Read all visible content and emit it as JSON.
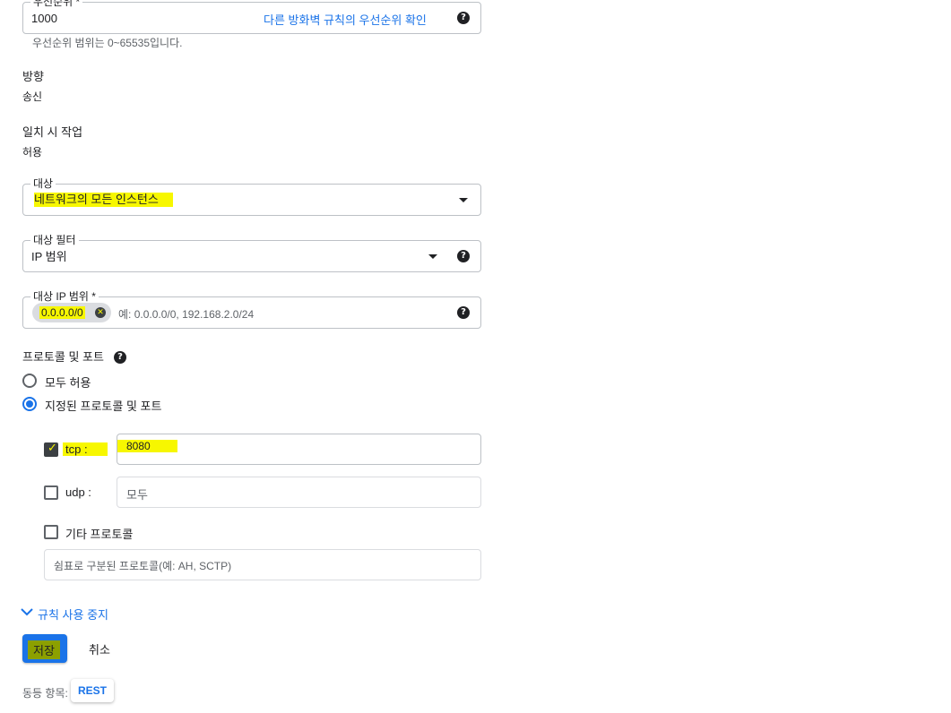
{
  "priority": {
    "label": "우선순위 *",
    "value": "1000",
    "link": "다른 방화벽 규칙의 우선순위 확인",
    "hint": "우선순위 범위는 0~65535입니다."
  },
  "direction": {
    "label": "방향",
    "value": "송신"
  },
  "action": {
    "label": "일치 시 작업",
    "value": "허용"
  },
  "target": {
    "label": "대상",
    "value": "네트워크의 모든 인스턴스"
  },
  "target_filter": {
    "label": "대상 필터",
    "value": "IP 범위"
  },
  "target_ip": {
    "label": "대상 IP 범위 *",
    "chip": "0.0.0.0/0",
    "placeholder": "예: 0.0.0.0/0, 192.168.2.0/24"
  },
  "protocols": {
    "label": "프로토콜 및 포트",
    "options": [
      "모두 허용",
      "지정된 프로토콜 및 포트"
    ],
    "selected_index": 1,
    "tcp": {
      "label": "tcp :",
      "checked": true,
      "value": "8080"
    },
    "udp": {
      "label": "udp :",
      "checked": false,
      "placeholder": "모두"
    },
    "other": {
      "label": "기타 프로토콜",
      "checked": false,
      "placeholder": "쉼표로 구분된 프로토콜(예: AH, SCTP)"
    }
  },
  "disable_rule_link": "규칙 사용 중지",
  "save_label": "저장",
  "cancel_label": "취소",
  "equivalent": {
    "label": "동등 항목:",
    "rest_label": "REST"
  },
  "colors": {
    "accent": "#1a73e8",
    "highlight": "#f7f700",
    "border": "#bdc1c6"
  }
}
